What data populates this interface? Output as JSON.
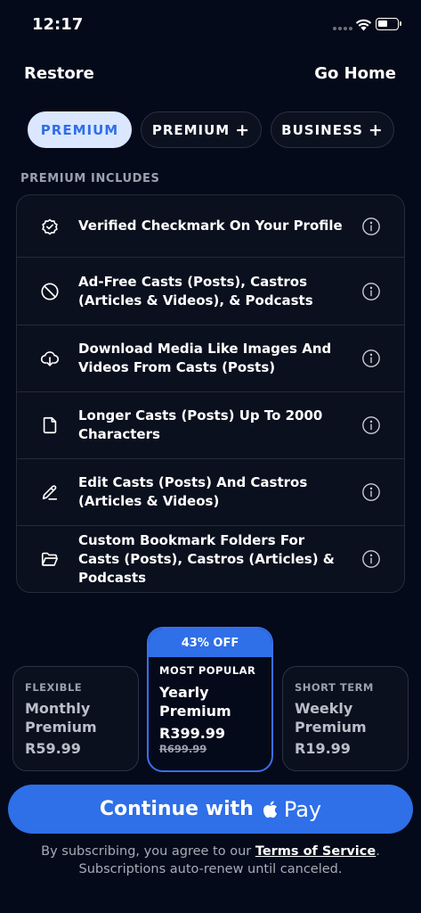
{
  "status": {
    "time": "12:17"
  },
  "nav": {
    "restore": "Restore",
    "go_home": "Go Home"
  },
  "tabs": [
    {
      "label": "PREMIUM",
      "active": true
    },
    {
      "label": "PREMIUM",
      "plus": "+"
    },
    {
      "label": "BUSINESS",
      "plus": "+"
    }
  ],
  "section_label": "PREMIUM INCLUDES",
  "features": [
    {
      "icon": "verified-badge-icon",
      "text": "Verified Checkmark On Your Profile"
    },
    {
      "icon": "no-ads-icon",
      "text": "Ad-Free Casts (Posts), Castros (Articles & Videos), & Podcasts"
    },
    {
      "icon": "cloud-download-icon",
      "text": "Download Media Like Images And Videos From Casts (Posts)"
    },
    {
      "icon": "document-icon",
      "text": "Longer Casts (Posts) Up To 2000 Characters"
    },
    {
      "icon": "pencil-icon",
      "text": "Edit Casts (Posts) And Castros (Articles & Videos)"
    },
    {
      "icon": "folder-icon",
      "text": "Custom Bookmark Folders For Casts (Posts), Castros (Articles) & Podcasts"
    }
  ],
  "plans": {
    "flexible": {
      "tag": "FLEXIBLE",
      "name": "Monthly Premium",
      "price": "R59.99"
    },
    "popular": {
      "badge": "43% OFF",
      "tag": "MOST POPULAR",
      "name": "Yearly Premium",
      "price": "R399.99",
      "old_price": "R699.99"
    },
    "short": {
      "tag": "SHORT TERM",
      "name": "Weekly Premium",
      "price": "R19.99"
    }
  },
  "cta": {
    "label": "Continue with",
    "pay": "Pay"
  },
  "legal": {
    "prefix": "By subscribing, you agree to our ",
    "tos": "Terms of Service",
    "suffix": ".",
    "line2": "Subscriptions auto-renew until canceled."
  },
  "colors": {
    "accent": "#2f6fe8",
    "background": "#050a1a",
    "tab_active_bg": "#dbe7ff"
  }
}
